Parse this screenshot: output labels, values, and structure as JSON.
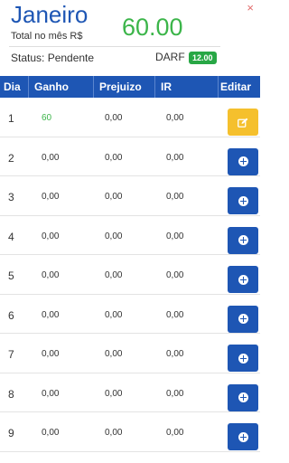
{
  "header": {
    "month": "Janeiro",
    "total_label": "Total no mês R$",
    "total_value": "60.00",
    "close_glyph": "×",
    "status": "Status: Pendente",
    "darf_label": "DARF",
    "darf_value": "12.00"
  },
  "table": {
    "columns": [
      "Dia",
      "Ganho",
      "Prejuizo",
      "IR",
      "Editar"
    ],
    "rows": [
      {
        "dia": "1",
        "ganho": "60",
        "prejuizo": "0,00",
        "ir": "0,00",
        "action": "edit-icon"
      },
      {
        "dia": "2",
        "ganho": "0,00",
        "prejuizo": "0,00",
        "ir": "0,00",
        "action": "plus-circle-icon"
      },
      {
        "dia": "3",
        "ganho": "0,00",
        "prejuizo": "0,00",
        "ir": "0,00",
        "action": "plus-circle-icon"
      },
      {
        "dia": "4",
        "ganho": "0,00",
        "prejuizo": "0,00",
        "ir": "0,00",
        "action": "plus-circle-icon"
      },
      {
        "dia": "5",
        "ganho": "0,00",
        "prejuizo": "0,00",
        "ir": "0,00",
        "action": "plus-circle-icon"
      },
      {
        "dia": "6",
        "ganho": "0,00",
        "prejuizo": "0,00",
        "ir": "0,00",
        "action": "plus-circle-icon"
      },
      {
        "dia": "7",
        "ganho": "0,00",
        "prejuizo": "0,00",
        "ir": "0,00",
        "action": "plus-circle-icon"
      },
      {
        "dia": "8",
        "ganho": "0,00",
        "prejuizo": "0,00",
        "ir": "0,00",
        "action": "plus-circle-icon"
      },
      {
        "dia": "9",
        "ganho": "0,00",
        "prejuizo": "0,00",
        "ir": "0,00",
        "action": "plus-circle-icon"
      }
    ]
  },
  "colors": {
    "primary": "#1e56b4",
    "positive": "#3cb54a",
    "warning": "#f5c02d",
    "badge": "#28a745",
    "close": "#e26b6b"
  }
}
